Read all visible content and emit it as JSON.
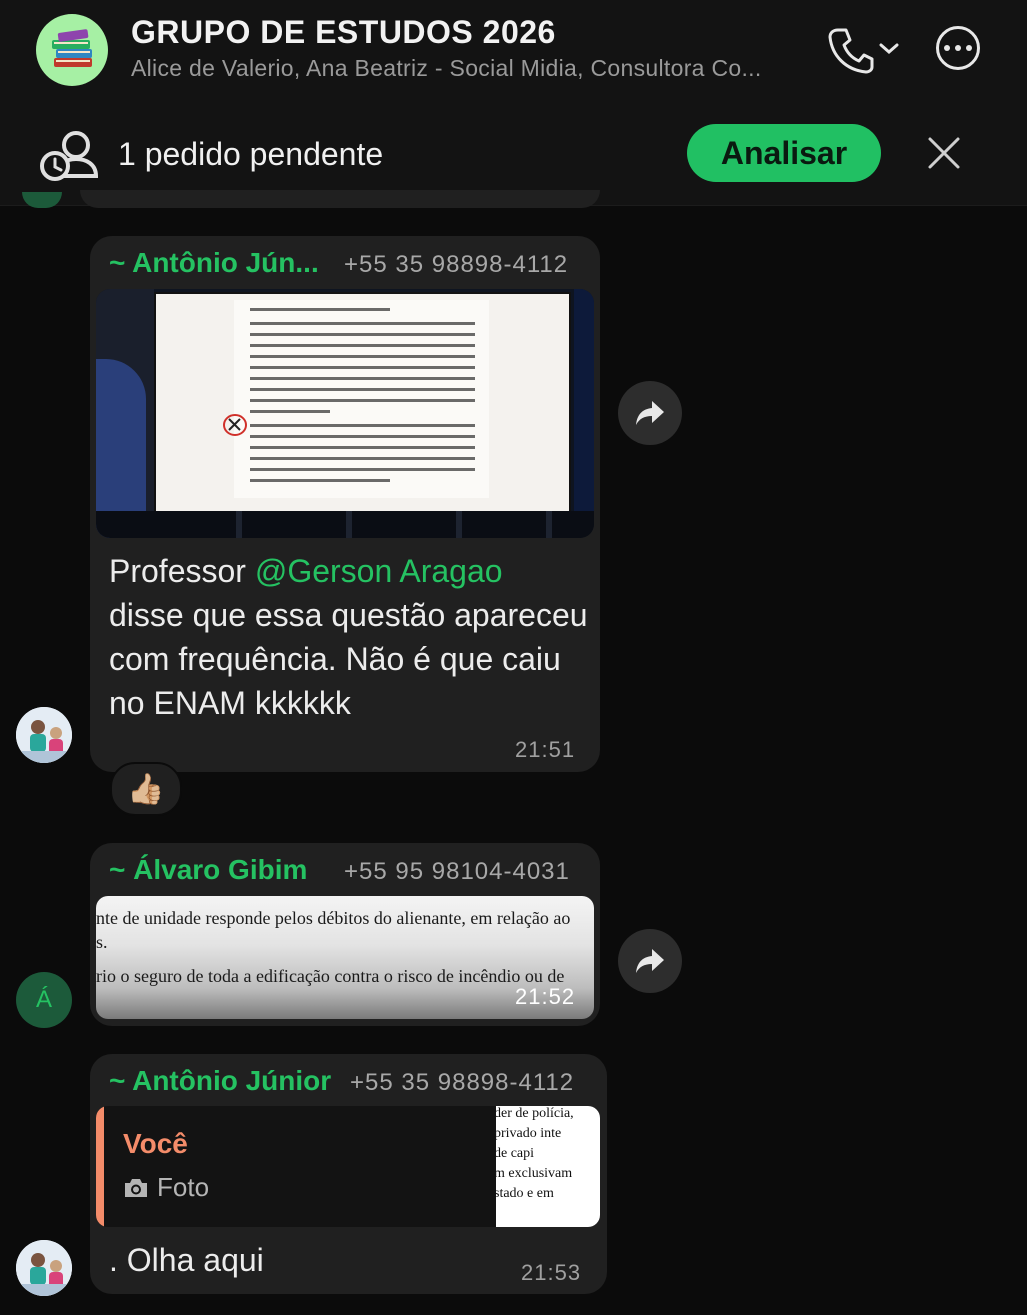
{
  "header": {
    "title": "GRUPO DE ESTUDOS 2026",
    "subtitle": "Alice de Valerio, Ana Beatriz - Social Midia, Consultora Co...",
    "avatar_icon": "books-icon",
    "call_icon": "phone-icon",
    "menu_icon": "more-icon"
  },
  "pending": {
    "text": "1 pedido pendente",
    "button_label": "Analisar",
    "dismiss_icon": "close-icon"
  },
  "messages": [
    {
      "sender": "~ Antônio Jún...",
      "phone": "+55 35 98898-4112",
      "text_prefix": "Professor ",
      "mention": "@Gerson Aragao",
      "text_rest": "disse que essa questão apareceu com frequência. Não é que caiu no ENAM kkkkkk",
      "time": "21:51",
      "reaction": "👍🏼"
    },
    {
      "sender": "~ Álvaro Gibim",
      "phone": "+55 95 98104-4031",
      "avatar_letter": "Á",
      "image_lines": [
        "nte de unidade responde pelos débitos do alienante, em relação ao",
        "s.",
        "rio o seguro de toda a edificação contra o risco de incêndio ou de"
      ],
      "time": "21:52"
    },
    {
      "sender": "~ Antônio Júnior",
      "phone": "+55 35 98898-4112",
      "quote_author": "Você",
      "quote_type": "Foto",
      "quote_thumb_lines": [
        "der de polícia,",
        "privado  inte",
        "de       capi",
        "m  exclusivam",
        "stado  e  em"
      ],
      "text": ". Olha aqui",
      "time": "21:53"
    }
  ],
  "colors": {
    "accent_green": "#25c262",
    "button_green": "#21c063",
    "bubble": "#202020",
    "background": "#0b0b0b",
    "quote_author": "#f48c6a"
  }
}
